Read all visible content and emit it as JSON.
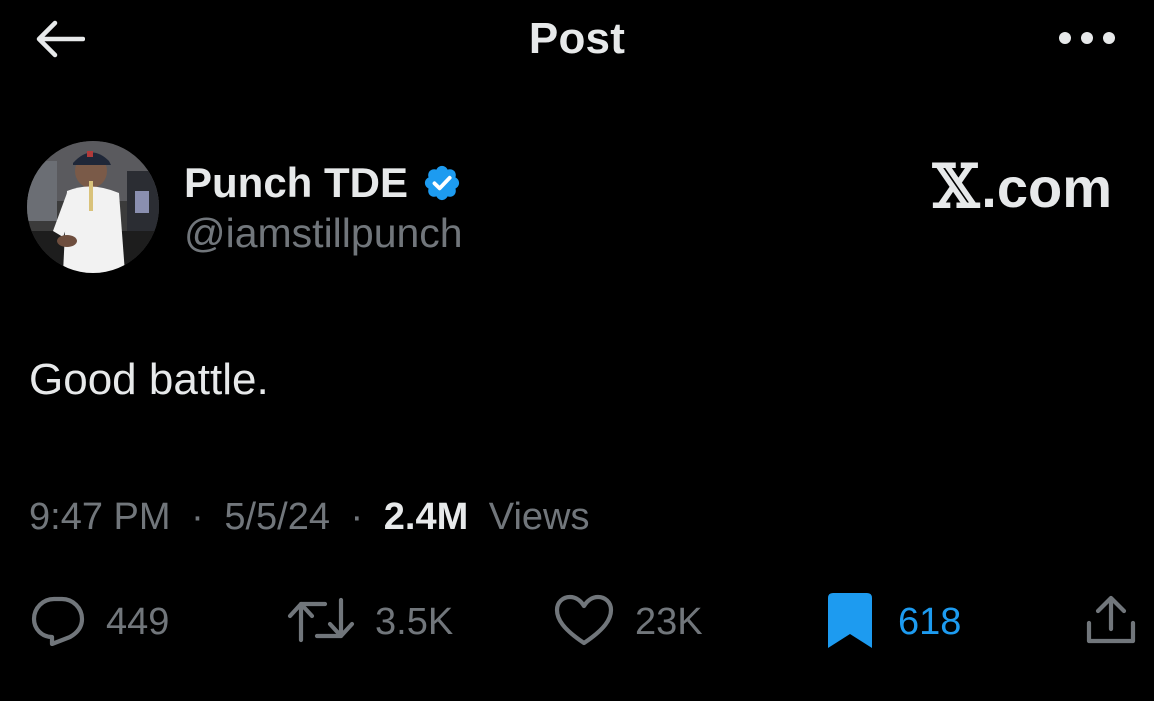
{
  "header": {
    "title": "Post",
    "back_icon": "arrow-left-icon",
    "more_icon": "ellipsis-horizontal-icon"
  },
  "author": {
    "display_name": "Punch TDE",
    "handle": "@iamstillpunch",
    "verified": true,
    "verified_color": "#1d9bf0"
  },
  "watermark": {
    "x_glyph": "𝕏",
    "suffix": ".com"
  },
  "post": {
    "text": "Good battle.",
    "time": "9:47 PM",
    "date": "5/5/24",
    "views_count": "2.4M",
    "views_label": "Views",
    "separator": "·"
  },
  "actions": {
    "replies": "449",
    "reposts": "3.5K",
    "likes": "23K",
    "bookmarks": "618",
    "bookmark_active_color": "#1d9bf0"
  },
  "colors": {
    "background": "#000000",
    "primary_text": "#e7e9ea",
    "secondary_text": "#71767b",
    "accent": "#1d9bf0"
  }
}
